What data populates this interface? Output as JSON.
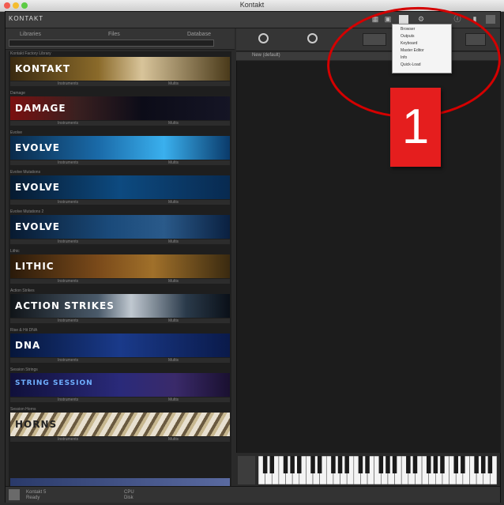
{
  "window": {
    "title": "Kontakt"
  },
  "colors": {
    "annotation_red": "#e51e1e",
    "panel_dark": "#1c1c1c",
    "toolbar": "#3c3c3c"
  },
  "topbar": {
    "logo": "KONTAKT"
  },
  "browser": {
    "tabs": [
      "Libraries",
      "Files",
      "Database"
    ],
    "search_placeholder": ""
  },
  "library": {
    "entries": [
      {
        "name": "Kontakt Factory Library",
        "banner": "KONTAKT",
        "strip": [
          "Instruments",
          "Multis"
        ]
      },
      {
        "name": "Damage",
        "banner": "DAMAGE",
        "strip": [
          "Instruments",
          "Multis"
        ]
      },
      {
        "name": "Evolve",
        "banner": "EVOLVE",
        "strip": [
          "Instruments",
          "Multis"
        ]
      },
      {
        "name": "Evolve Mutations",
        "banner": "EVOLVE",
        "strip": [
          "Instruments",
          "Multis"
        ]
      },
      {
        "name": "Evolve Mutations 2",
        "banner": "EVOLVE",
        "strip": [
          "Instruments",
          "Multis"
        ]
      },
      {
        "name": "Lithic",
        "banner": "LITHIC",
        "strip": [
          "Instruments",
          "Multis"
        ]
      },
      {
        "name": "Action Strikes",
        "banner": "ACTION STRIKES",
        "strip": [
          "Instruments",
          "Multis"
        ]
      },
      {
        "name": "Rise & Hit DNA",
        "banner": "DNA",
        "strip": [
          "Instruments",
          "Multis"
        ]
      },
      {
        "name": "Session Strings",
        "banner": "STRING SESSION",
        "strip": [
          "Instruments",
          "Multis"
        ]
      },
      {
        "name": "Session Horns",
        "banner": "HORNS",
        "strip": [
          "Instruments",
          "Multis"
        ]
      }
    ]
  },
  "rack": {
    "header_label": "New (default)"
  },
  "dropdown": {
    "items": [
      "Browser",
      "Outputs",
      "Keyboard",
      "Master Editor",
      "Info",
      "Quick-Load"
    ]
  },
  "status": {
    "left_text": [
      "Kontakt 5",
      "Ready"
    ],
    "mid_text": [
      "CPU",
      "Disk"
    ]
  },
  "annotation": {
    "number": "1"
  }
}
